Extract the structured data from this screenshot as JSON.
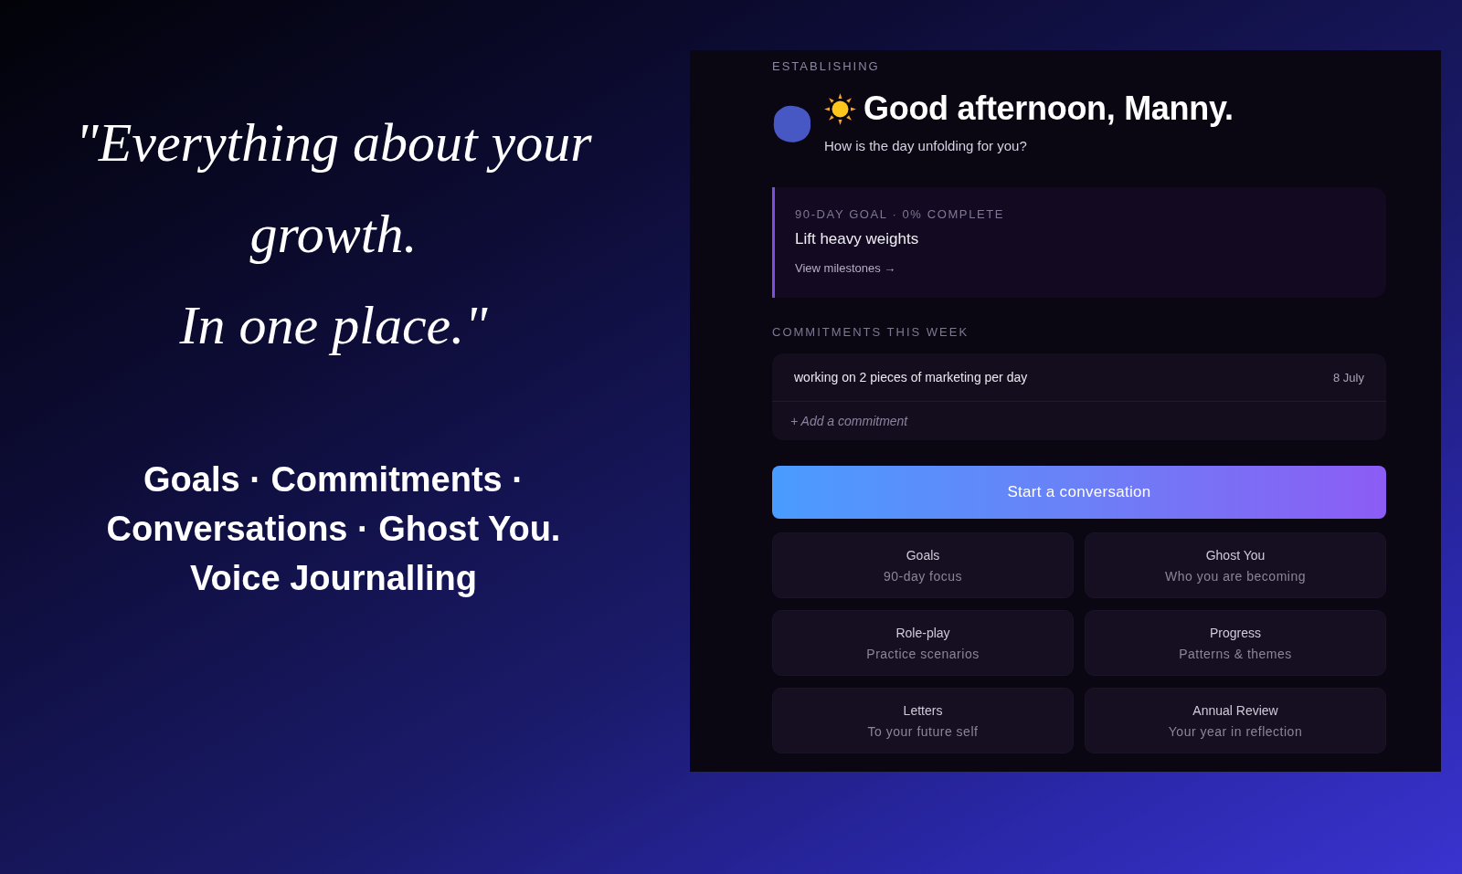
{
  "hero": {
    "quote_lines": [
      "\"Everything about your",
      "growth.",
      "In one place.\""
    ],
    "feature_lines": [
      "Goals · Commitments ·",
      "Conversations · Ghost You.",
      "Voice Journalling"
    ]
  },
  "panel": {
    "stage": "ESTABLISHING",
    "greeting": "Good afternoon, Manny.",
    "subtitle": "How is the day unfolding for you?",
    "goal": {
      "meta": "90-DAY GOAL · 0% COMPLETE",
      "title": "Lift heavy weights",
      "link": "View milestones →"
    },
    "commitments": {
      "heading": "COMMITMENTS THIS WEEK",
      "items": [
        {
          "text": "working on 2 pieces of marketing per day",
          "date": "8 July"
        }
      ],
      "add_label": "+ Add a commitment"
    },
    "primary_button": "Start a conversation",
    "shortcuts": [
      {
        "title": "Goals",
        "subtitle": "90-day focus"
      },
      {
        "title": "Ghost You",
        "subtitle": "Who you are becoming"
      },
      {
        "title": "Role-play",
        "subtitle": "Practice scenarios"
      },
      {
        "title": "Progress",
        "subtitle": "Patterns & themes"
      },
      {
        "title": "Letters",
        "subtitle": "To your future self"
      },
      {
        "title": "Annual Review",
        "subtitle": "Your year in reflection"
      }
    ]
  }
}
